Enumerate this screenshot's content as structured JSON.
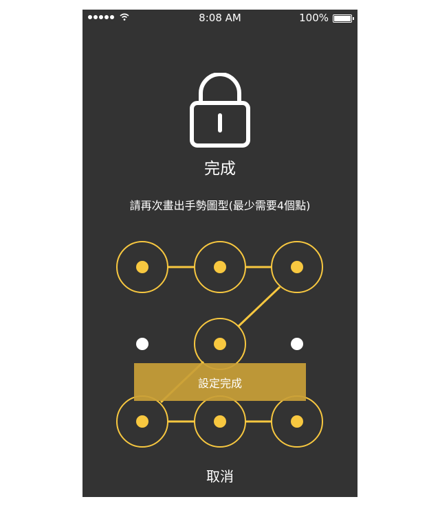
{
  "status_bar": {
    "time": "8:08 AM",
    "battery": "100%",
    "signal_icon": "signal-dots-icon",
    "wifi_icon": "wifi-icon",
    "battery_icon": "battery-icon"
  },
  "lock_icon": "lock-icon",
  "title": "完成",
  "instruction": "請再次畫出手勢圖型(最少需要4個點)",
  "pattern": {
    "accent_color": "#F8C840",
    "selected_nodes": [
      1,
      2,
      3,
      5,
      7,
      8,
      9
    ],
    "unselected_nodes": [
      4,
      6
    ],
    "path_order": [
      1,
      2,
      3,
      5,
      7,
      8,
      9
    ]
  },
  "banner": {
    "label": "設定完成",
    "color": "#C9A037"
  },
  "cancel_label": "取消"
}
